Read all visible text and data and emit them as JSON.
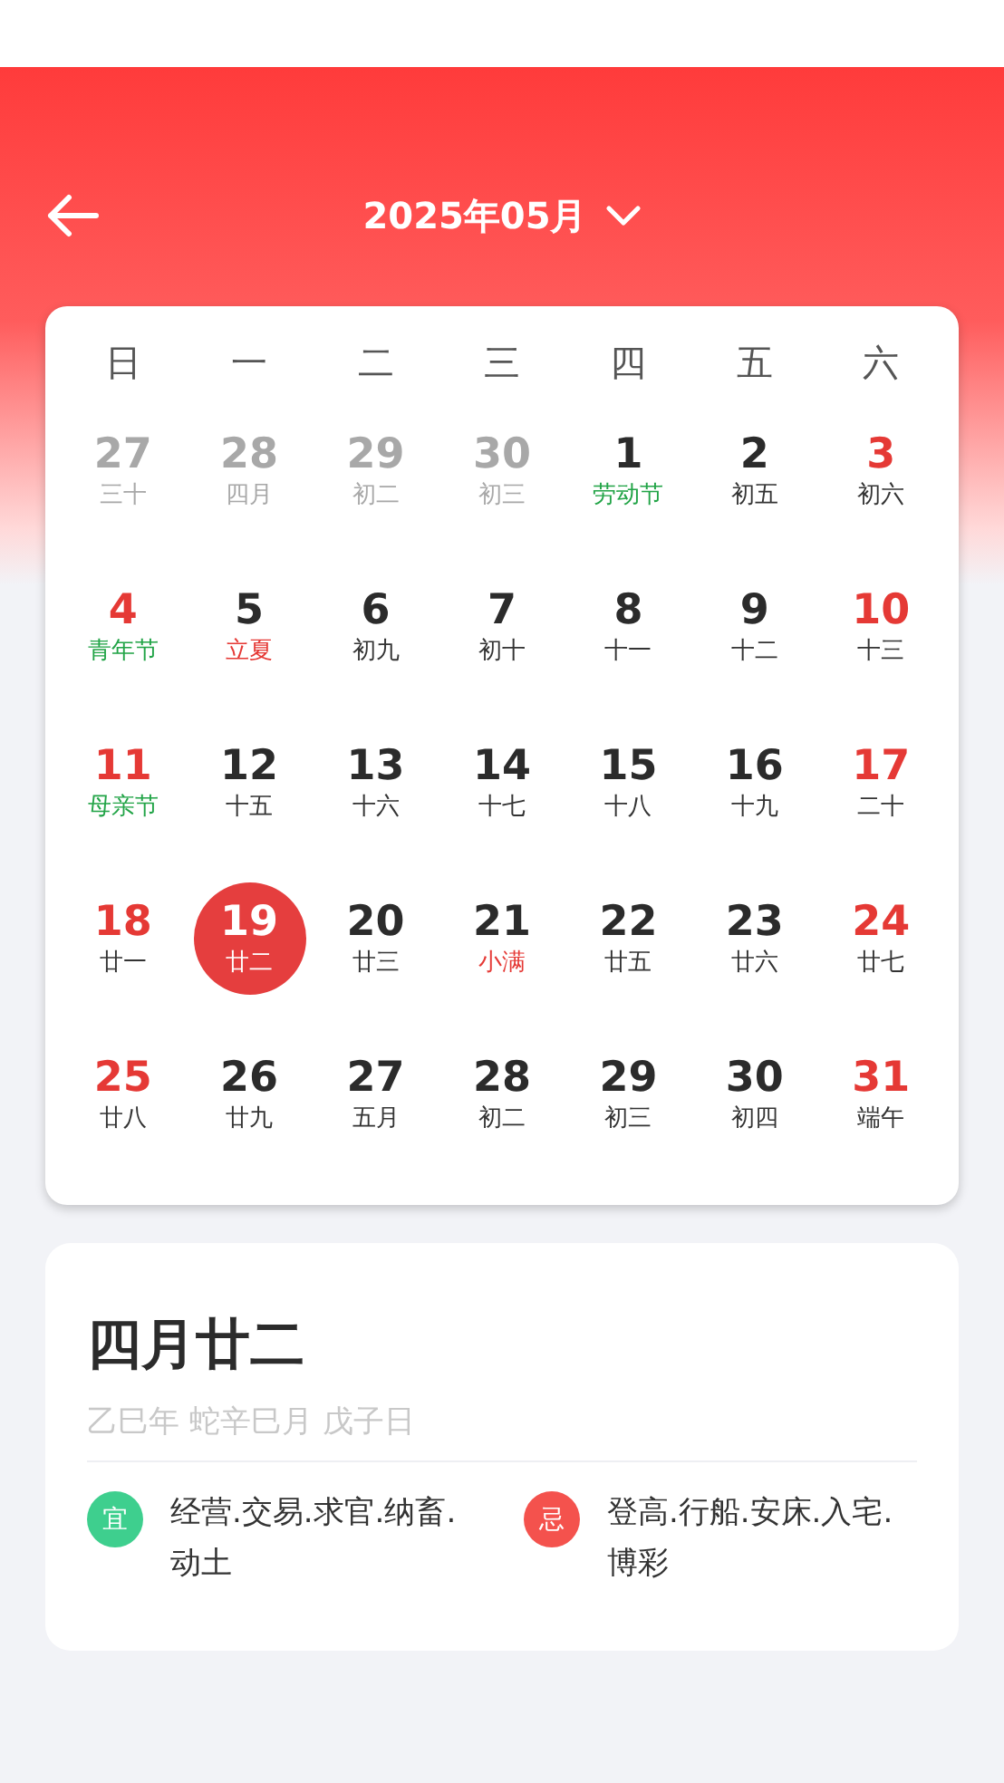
{
  "header": {
    "title": "2025年05月"
  },
  "weekdays": [
    "日",
    "一",
    "二",
    "三",
    "四",
    "五",
    "六"
  ],
  "days": [
    {
      "day": "27",
      "lunar": "三十",
      "kind": "other",
      "festival": false,
      "solar_term": false,
      "selected": false
    },
    {
      "day": "28",
      "lunar": "四月",
      "kind": "other",
      "festival": false,
      "solar_term": false,
      "selected": false
    },
    {
      "day": "29",
      "lunar": "初二",
      "kind": "other",
      "festival": false,
      "solar_term": false,
      "selected": false
    },
    {
      "day": "30",
      "lunar": "初三",
      "kind": "other",
      "festival": false,
      "solar_term": false,
      "selected": false
    },
    {
      "day": "1",
      "lunar": "劳动节",
      "kind": "workday",
      "festival": true,
      "solar_term": false,
      "selected": false
    },
    {
      "day": "2",
      "lunar": "初五",
      "kind": "workday",
      "festival": false,
      "solar_term": false,
      "selected": false
    },
    {
      "day": "3",
      "lunar": "初六",
      "kind": "weekend",
      "festival": false,
      "solar_term": false,
      "selected": false
    },
    {
      "day": "4",
      "lunar": "青年节",
      "kind": "weekend",
      "festival": true,
      "solar_term": false,
      "selected": false
    },
    {
      "day": "5",
      "lunar": "立夏",
      "kind": "workday",
      "festival": false,
      "solar_term": true,
      "selected": false
    },
    {
      "day": "6",
      "lunar": "初九",
      "kind": "workday",
      "festival": false,
      "solar_term": false,
      "selected": false
    },
    {
      "day": "7",
      "lunar": "初十",
      "kind": "workday",
      "festival": false,
      "solar_term": false,
      "selected": false
    },
    {
      "day": "8",
      "lunar": "十一",
      "kind": "workday",
      "festival": false,
      "solar_term": false,
      "selected": false
    },
    {
      "day": "9",
      "lunar": "十二",
      "kind": "workday",
      "festival": false,
      "solar_term": false,
      "selected": false
    },
    {
      "day": "10",
      "lunar": "十三",
      "kind": "weekend",
      "festival": false,
      "solar_term": false,
      "selected": false
    },
    {
      "day": "11",
      "lunar": "母亲节",
      "kind": "weekend",
      "festival": true,
      "solar_term": false,
      "selected": false
    },
    {
      "day": "12",
      "lunar": "十五",
      "kind": "workday",
      "festival": false,
      "solar_term": false,
      "selected": false
    },
    {
      "day": "13",
      "lunar": "十六",
      "kind": "workday",
      "festival": false,
      "solar_term": false,
      "selected": false
    },
    {
      "day": "14",
      "lunar": "十七",
      "kind": "workday",
      "festival": false,
      "solar_term": false,
      "selected": false
    },
    {
      "day": "15",
      "lunar": "十八",
      "kind": "workday",
      "festival": false,
      "solar_term": false,
      "selected": false
    },
    {
      "day": "16",
      "lunar": "十九",
      "kind": "workday",
      "festival": false,
      "solar_term": false,
      "selected": false
    },
    {
      "day": "17",
      "lunar": "二十",
      "kind": "weekend",
      "festival": false,
      "solar_term": false,
      "selected": false
    },
    {
      "day": "18",
      "lunar": "廿一",
      "kind": "weekend",
      "festival": false,
      "solar_term": false,
      "selected": false
    },
    {
      "day": "19",
      "lunar": "廿二",
      "kind": "workday",
      "festival": false,
      "solar_term": false,
      "selected": true
    },
    {
      "day": "20",
      "lunar": "廿三",
      "kind": "workday",
      "festival": false,
      "solar_term": false,
      "selected": false
    },
    {
      "day": "21",
      "lunar": "小满",
      "kind": "workday",
      "festival": false,
      "solar_term": true,
      "selected": false
    },
    {
      "day": "22",
      "lunar": "廿五",
      "kind": "workday",
      "festival": false,
      "solar_term": false,
      "selected": false
    },
    {
      "day": "23",
      "lunar": "廿六",
      "kind": "workday",
      "festival": false,
      "solar_term": false,
      "selected": false
    },
    {
      "day": "24",
      "lunar": "廿七",
      "kind": "weekend",
      "festival": false,
      "solar_term": false,
      "selected": false
    },
    {
      "day": "25",
      "lunar": "廿八",
      "kind": "weekend",
      "festival": false,
      "solar_term": false,
      "selected": false
    },
    {
      "day": "26",
      "lunar": "廿九",
      "kind": "workday",
      "festival": false,
      "solar_term": false,
      "selected": false
    },
    {
      "day": "27",
      "lunar": "五月",
      "kind": "workday",
      "festival": false,
      "solar_term": false,
      "selected": false
    },
    {
      "day": "28",
      "lunar": "初二",
      "kind": "workday",
      "festival": false,
      "solar_term": false,
      "selected": false
    },
    {
      "day": "29",
      "lunar": "初三",
      "kind": "workday",
      "festival": false,
      "solar_term": false,
      "selected": false
    },
    {
      "day": "30",
      "lunar": "初四",
      "kind": "workday",
      "festival": false,
      "solar_term": false,
      "selected": false
    },
    {
      "day": "31",
      "lunar": "端午",
      "kind": "weekend",
      "festival": false,
      "solar_term": false,
      "selected": false
    }
  ],
  "detail": {
    "lunar_date": "四月廿二",
    "ganzhi": "乙巳年 蛇辛巳月 戊子日",
    "items": [
      {
        "badge": "宜",
        "text": "经营.交易.求官.纳畜.动土",
        "color": "#3ecf8e"
      },
      {
        "badge": "忌",
        "text": "登高.行船.安床.入宅.博彩",
        "color": "#f4524d"
      }
    ]
  }
}
